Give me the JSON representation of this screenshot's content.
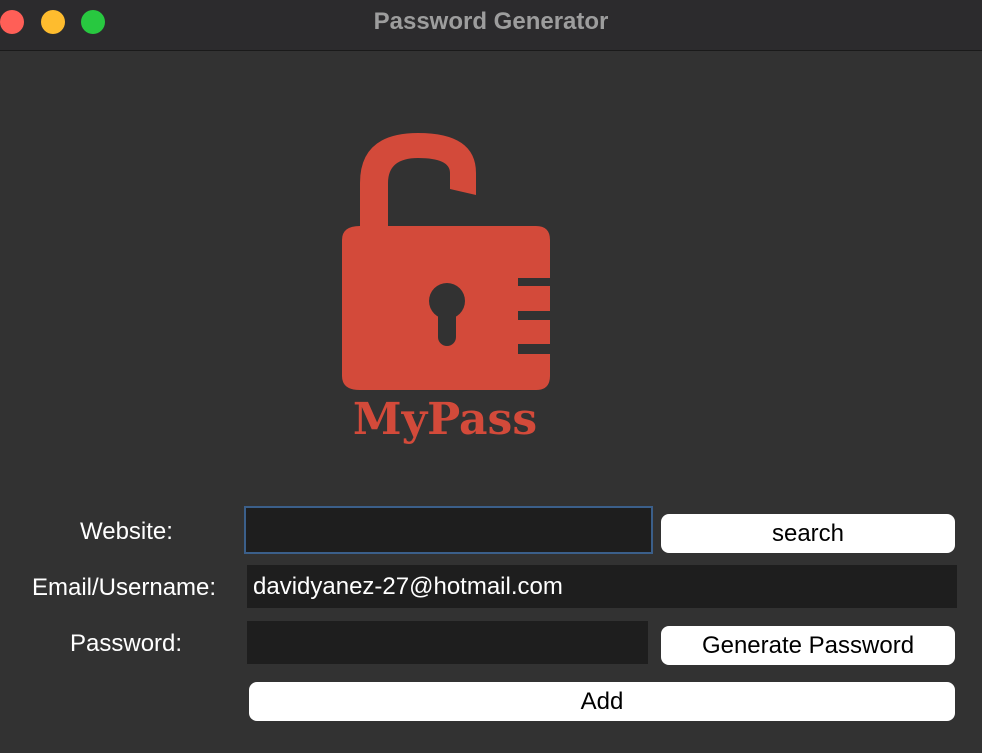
{
  "window": {
    "title": "Password Generator"
  },
  "logo": {
    "text": "MyPass",
    "color": "#d34a3a",
    "icon": "padlock-icon"
  },
  "form": {
    "website_label": "Website:",
    "website_value": "",
    "email_label": "Email/Username:",
    "email_value": "davidyanez-27@hotmail.com",
    "password_label": "Password:",
    "password_value": ""
  },
  "buttons": {
    "search": "search",
    "generate": "Generate Password",
    "add": "Add"
  }
}
